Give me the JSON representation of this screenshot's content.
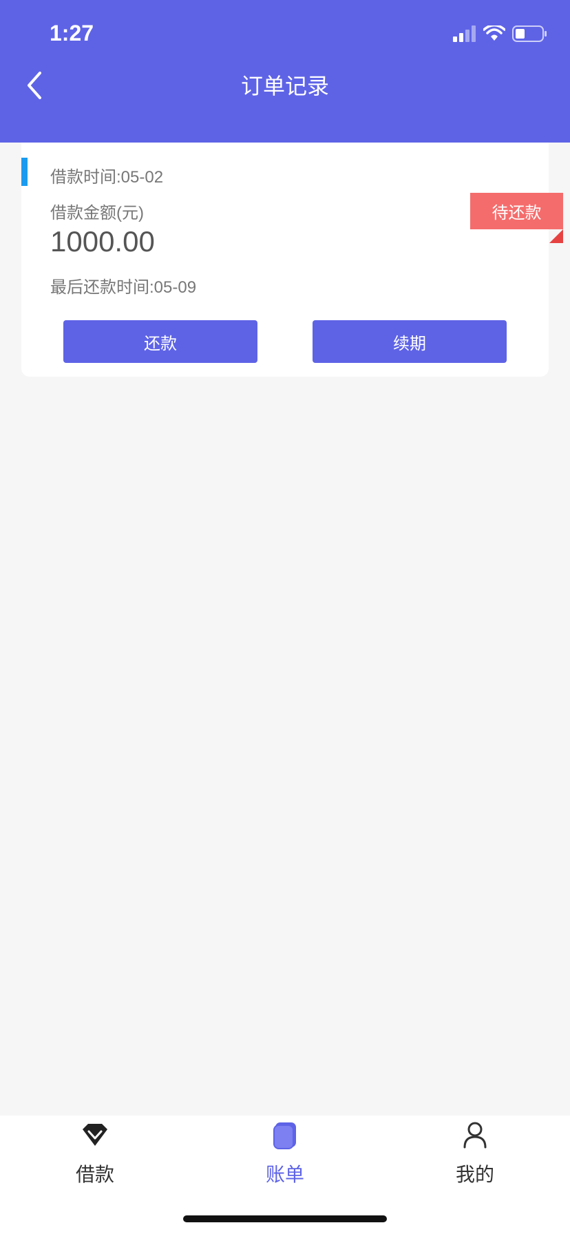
{
  "status_bar": {
    "time": "1:27"
  },
  "header": {
    "title": "订单记录"
  },
  "order": {
    "loan_time": "借款时间:05-02",
    "amount_label": "借款金额(元)",
    "amount_value": "1000.00",
    "last_repay_time": "最后还款时间:05-09",
    "status": "待还款",
    "repay_button": "还款",
    "renew_button": "续期"
  },
  "tabbar": {
    "items": [
      {
        "label": "借款",
        "icon": "diamond-icon",
        "active": false
      },
      {
        "label": "账单",
        "icon": "bill-icon",
        "active": true
      },
      {
        "label": "我的",
        "icon": "user-icon",
        "active": false
      }
    ]
  },
  "colors": {
    "primary": "#5e63e6",
    "accent_bar": "#1a9bf0",
    "status_badge": "#f56c6c"
  }
}
